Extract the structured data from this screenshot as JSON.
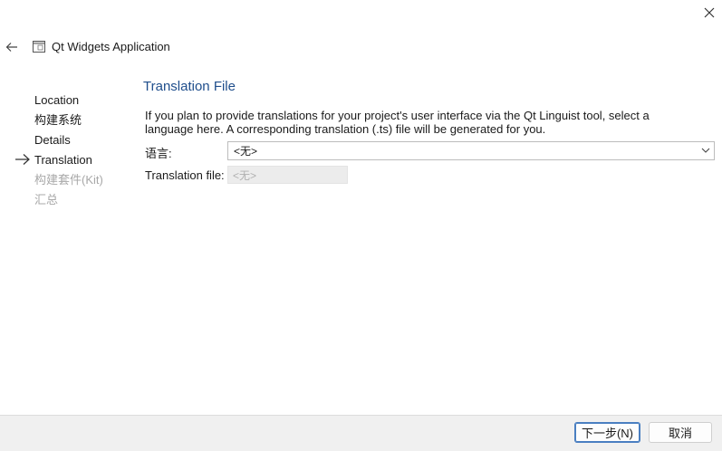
{
  "window": {
    "title": "Qt Widgets Application"
  },
  "steps": [
    {
      "label": "Location",
      "state": "done"
    },
    {
      "label": "构建系统",
      "state": "done"
    },
    {
      "label": "Details",
      "state": "done"
    },
    {
      "label": "Translation",
      "state": "current"
    },
    {
      "label": "构建套件(Kit)",
      "state": "disabled"
    },
    {
      "label": "汇总",
      "state": "disabled"
    }
  ],
  "page": {
    "title": "Translation File",
    "description_line1": "If you plan to provide translations for your project's user interface via the Qt Linguist tool, select a",
    "description_line2": "language here. A corresponding translation (.ts) file will be generated for you.",
    "language_label": "语言:",
    "language_value": "<无>",
    "translation_file_label": "Translation file:",
    "translation_file_value": "<无>"
  },
  "buttons": {
    "next": "下一步(N)",
    "cancel": "取消"
  },
  "colors": {
    "title_blue": "#1f4e8c",
    "disabled_text": "#a8a8a8",
    "default_button_border": "#4a7fc1"
  }
}
